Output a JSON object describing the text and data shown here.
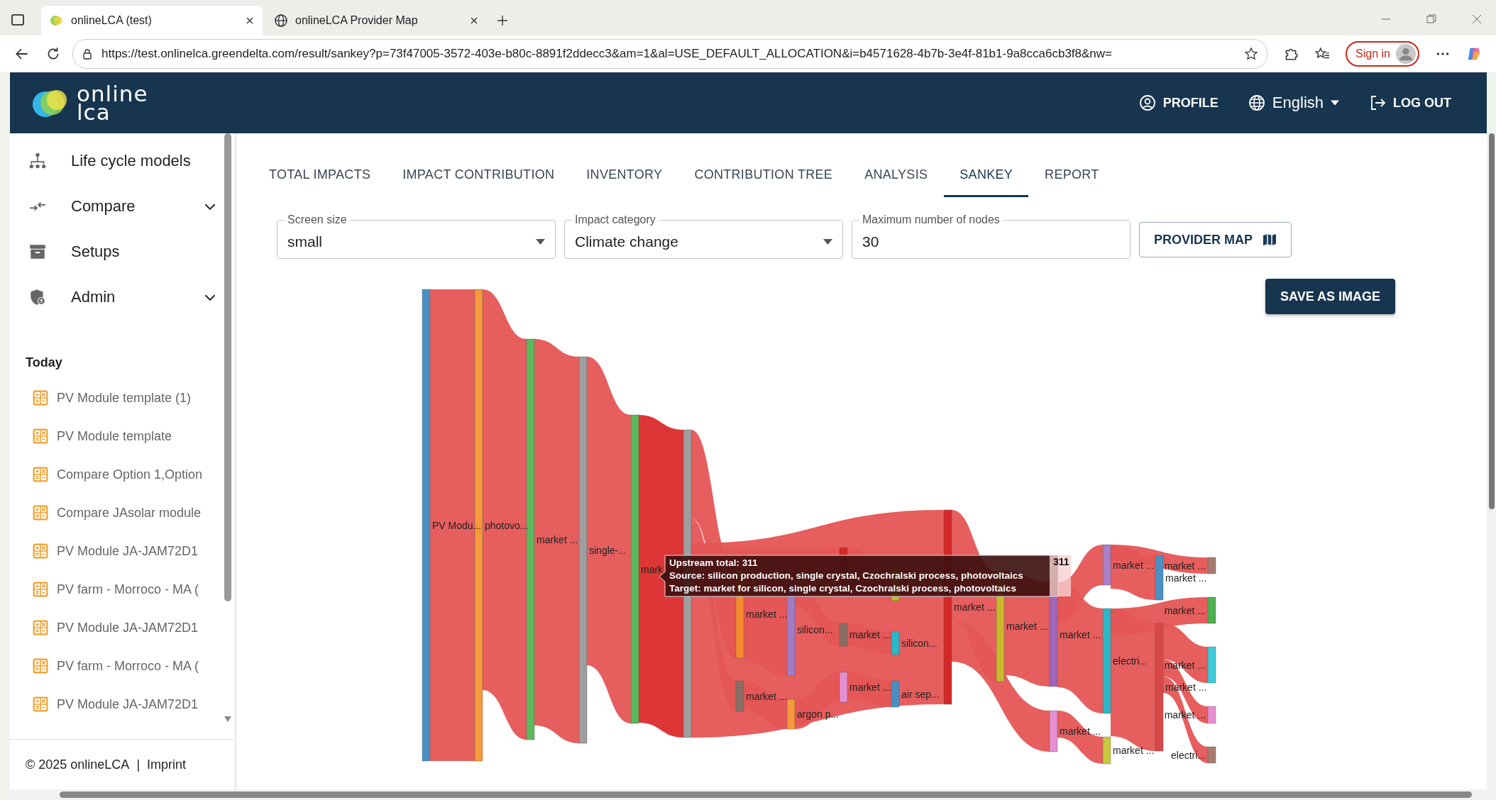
{
  "browser": {
    "tabs": [
      {
        "title": "onlineLCA (test)",
        "selected": true,
        "kind": "app"
      },
      {
        "title": "onlineLCA Provider Map",
        "selected": false,
        "kind": "web"
      }
    ],
    "url": "https://test.onlinelca.greendelta.com/result/sankey?p=73f47005-3572-403e-b80c-8891f2ddecc3&am=1&al=USE_DEFAULT_ALLOCATION&i=b4571628-4b7b-3e4f-81b1-9a8cca6cb3f8&nw=",
    "sign_in": "Sign in"
  },
  "header": {
    "logo": [
      "online",
      "lca"
    ],
    "profile": "PROFILE",
    "language": "English",
    "logout": "LOG OUT"
  },
  "sidebar": {
    "items": [
      {
        "label": "Life cycle models",
        "kind": "link"
      },
      {
        "label": "Compare",
        "kind": "menu",
        "expanded": false
      },
      {
        "label": "Setups",
        "kind": "link"
      },
      {
        "label": "Admin",
        "kind": "menu",
        "expanded": false
      }
    ],
    "section": "Today",
    "recent": [
      "PV Module template (1)",
      "PV Module template",
      "Compare Option 1,Option",
      "Compare JAsolar module",
      "PV Module JA-JAM72D1",
      "PV farm - Morroco - MA (",
      "PV Module JA-JAM72D1",
      "PV farm - Morroco - MA (",
      "PV Module JA-JAM72D1"
    ],
    "footer": {
      "copyright": "© 2025 onlineLCA",
      "separator": "|",
      "link": "Imprint"
    }
  },
  "tabs": [
    {
      "label": "TOTAL IMPACTS",
      "selected": false
    },
    {
      "label": "IMPACT CONTRIBUTION",
      "selected": false
    },
    {
      "label": "INVENTORY",
      "selected": false
    },
    {
      "label": "CONTRIBUTION TREE",
      "selected": false
    },
    {
      "label": "ANALYSIS",
      "selected": false
    },
    {
      "label": "SANKEY",
      "selected": true
    },
    {
      "label": "REPORT",
      "selected": false
    }
  ],
  "fields": [
    {
      "label": "Screen size",
      "value": "small",
      "kind": "select"
    },
    {
      "label": "Impact category",
      "value": "Climate change",
      "kind": "select"
    },
    {
      "label": "Maximum number of nodes",
      "value": "30",
      "kind": "input"
    }
  ],
  "provider_map_button": "PROVIDER MAP",
  "save_button": "SAVE AS IMAGE",
  "sankey": {
    "nodes": [
      {
        "label": "PV Modu...",
        "color": "#4a90c4"
      },
      {
        "label": "photovo...",
        "color": "#f5993a"
      },
      {
        "label": "market ...",
        "color": "#5cb85c"
      },
      {
        "label": "single-...",
        "color": "#9e9e9e"
      },
      {
        "label": "mark",
        "color": "#5cb85c"
      },
      {
        "color": "#9e9e9e"
      },
      {
        "label": "market ...",
        "color": "#f58a2a"
      },
      {
        "label": "market ...",
        "color": "#8c6d62"
      },
      {
        "label": "silicon...",
        "color": "#a07cc5"
      },
      {
        "label": "argon p...",
        "color": "#f5993a"
      },
      {
        "color": "#d62728"
      },
      {
        "label": "market ...",
        "color": "#8c6d62"
      },
      {
        "label": "market ...",
        "color": "#e58fd0"
      },
      {
        "color": "#bcbd22"
      },
      {
        "label": "silicon...",
        "color": "#2bb8c8"
      },
      {
        "label": "air sep...",
        "color": "#4a8fc4"
      },
      {
        "label": "market ...",
        "color": "#d62728"
      },
      {
        "label": "market ...",
        "color": "#c8b92a"
      },
      {
        "label": "market ...",
        "color": "#a067b8"
      },
      {
        "label": "market ...",
        "color": "#e58fd0"
      },
      {
        "label": "market ...",
        "color": "#a880c8"
      },
      {
        "label": "electri...",
        "color": "#2bb8c8"
      },
      {
        "label": "market ...",
        "color": "#c8c83c"
      },
      {
        "label": "market ...",
        "color": "#a87a70"
      },
      {
        "label": "market ...",
        "color": "#4a90c4"
      },
      {
        "label": "market ...",
        "color": "#4caf50"
      },
      {
        "label": "market ...",
        "color": "#40cad8"
      },
      {
        "label": "market ...",
        "color": "#d94848"
      },
      {
        "label": "market ...",
        "color": "#e88fd0"
      },
      {
        "label": "electri...",
        "color": "#a87a70"
      }
    ],
    "hover_value": "311",
    "tooltip": [
      "Upstream total: 311",
      "Source: silicon production, single crystal, Czochralski process, photovoltaics",
      "Target: market for silicon, single crystal, Czochralski process, photovoltaics"
    ]
  }
}
